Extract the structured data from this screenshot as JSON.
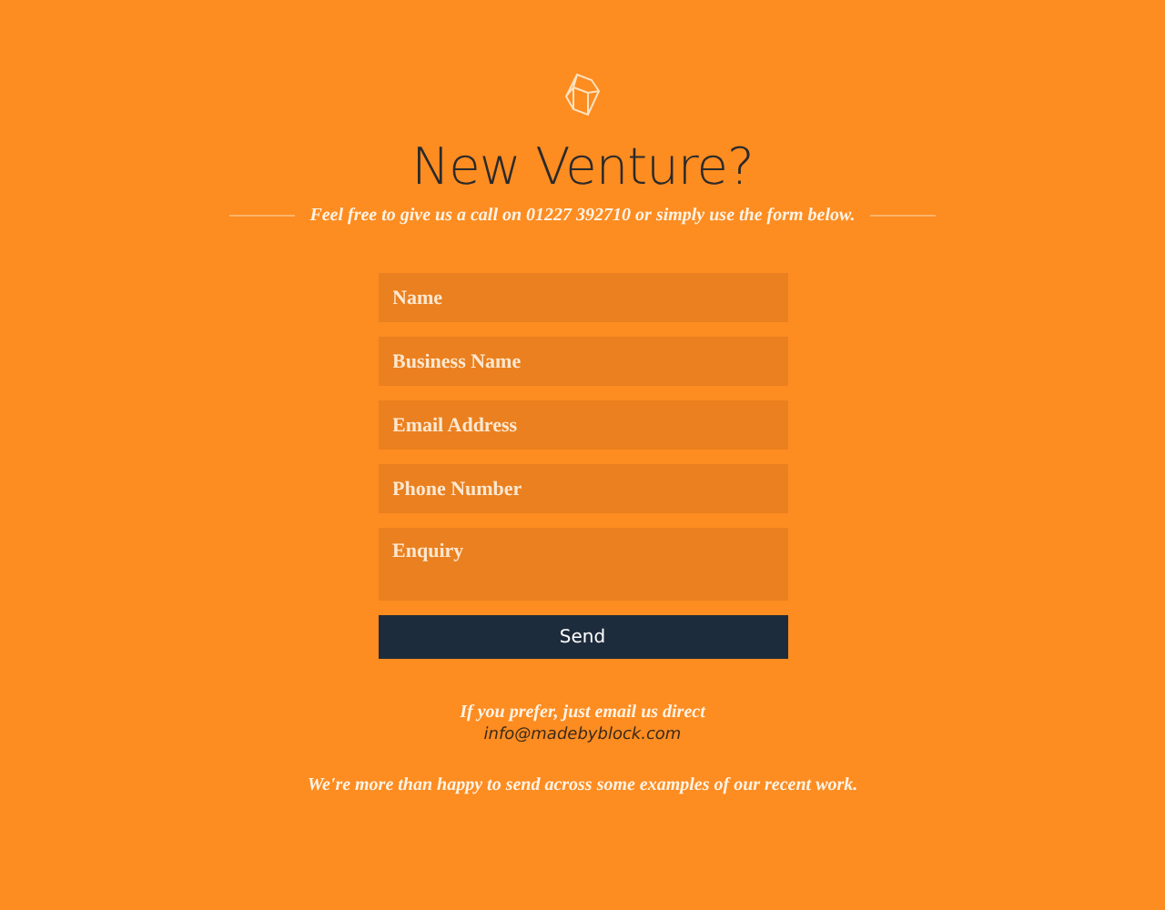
{
  "heading": "New Venture?",
  "tagline": "Feel free to give us a call on 01227 392710 or simply use the form below.",
  "form": {
    "fields": [
      {
        "kind": "input",
        "placeholder": "Name"
      },
      {
        "kind": "input",
        "placeholder": "Business Name"
      },
      {
        "kind": "input",
        "placeholder": "Email Address"
      },
      {
        "kind": "input",
        "placeholder": "Phone Number"
      },
      {
        "kind": "textarea",
        "placeholder": "Enquiry"
      }
    ],
    "submit": "Send"
  },
  "email_prompt": "If you prefer, just email us direct",
  "email": "info@madebyblock.com",
  "footer_note": "We're more than happy to send across some examples of our recent work."
}
